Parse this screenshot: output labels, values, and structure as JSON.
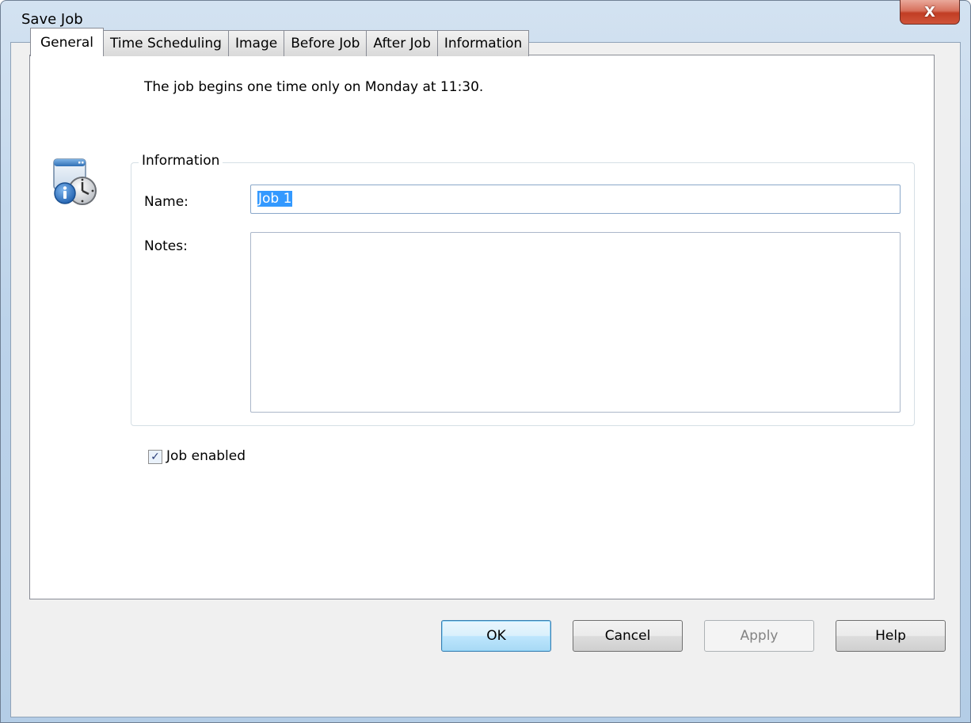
{
  "window": {
    "title": "Save Job",
    "close_glyph": "X"
  },
  "tabs": [
    {
      "label": "General",
      "active": true
    },
    {
      "label": "Time Scheduling",
      "active": false
    },
    {
      "label": "Image",
      "active": false
    },
    {
      "label": "Before Job",
      "active": false
    },
    {
      "label": "After Job",
      "active": false
    },
    {
      "label": "Information",
      "active": false
    }
  ],
  "general": {
    "summary": "The job begins one time only on Monday at 11:30.",
    "icon": "job-info-clock-icon",
    "group_title": "Information",
    "name_label": "Name:",
    "name_value": "Job 1",
    "notes_label": "Notes:",
    "notes_value": "",
    "job_enabled_label": "Job enabled",
    "job_enabled_checked": true,
    "check_glyph": "✓"
  },
  "buttons": {
    "ok": "OK",
    "cancel": "Cancel",
    "apply": "Apply",
    "help": "Help"
  },
  "colors": {
    "selection": "#3399ff",
    "close_button": "#c13d24",
    "title_bar": "#bcd3ea"
  }
}
